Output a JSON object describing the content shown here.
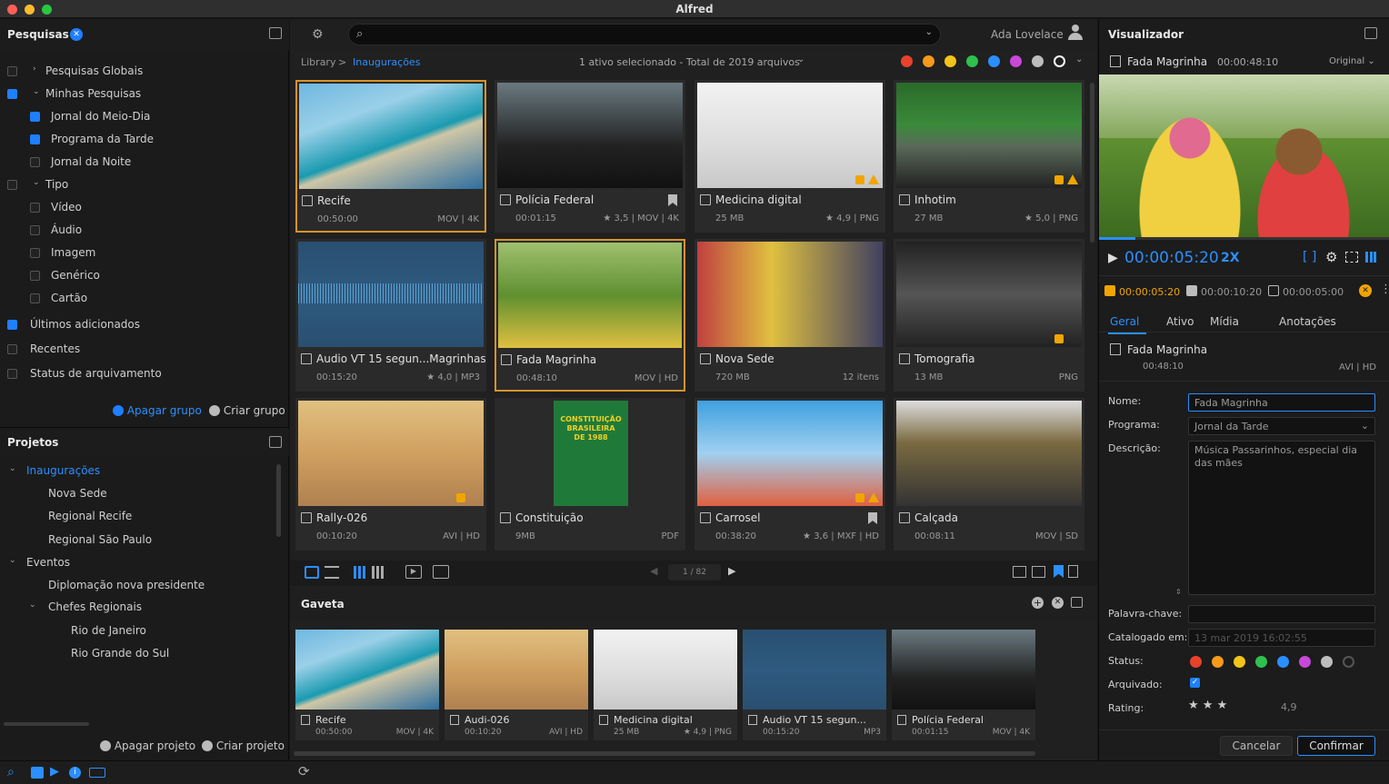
{
  "window": {
    "title": "Alfred"
  },
  "searches": {
    "title": "Pesquisas",
    "items": [
      {
        "label": "Pesquisas Globais"
      },
      {
        "label": "Minhas Pesquisas"
      },
      {
        "label": "Jornal do Meio-Dia"
      },
      {
        "label": "Programa da Tarde"
      },
      {
        "label": "Jornal da Noite"
      },
      {
        "label": "Tipo"
      },
      {
        "label": "Vídeo"
      },
      {
        "label": "Áudio"
      },
      {
        "label": "Imagem"
      },
      {
        "label": "Genérico"
      },
      {
        "label": "Cartão"
      },
      {
        "label": "Últimos adicionados"
      },
      {
        "label": "Recentes"
      },
      {
        "label": "Status de arquivamento"
      }
    ],
    "delete_group": "Apagar grupo",
    "create_group": "Criar grupo"
  },
  "projects": {
    "title": "Projetos",
    "items": [
      {
        "label": "Inaugurações"
      },
      {
        "label": "Nova Sede"
      },
      {
        "label": "Regional Recife"
      },
      {
        "label": "Regional São Paulo"
      },
      {
        "label": "Eventos"
      },
      {
        "label": "Diplomação nova presidente"
      },
      {
        "label": "Chefes Regionais"
      },
      {
        "label": "Rio de Janeiro"
      },
      {
        "label": "Rio Grande do Sul"
      }
    ],
    "delete_project": "Apagar projeto",
    "create_project": "Criar projeto"
  },
  "header": {
    "user": "Ada Lovelace"
  },
  "breadcrumb": {
    "root": "Library",
    "sep": ">",
    "current": "Inaugurações"
  },
  "selection_info": "1 ativo selecionado - Total de 2019 arquivos",
  "color_filters": [
    "#e8412c",
    "#f59a1b",
    "#f2c41a",
    "#2fc04d",
    "#2b8fff",
    "#c848d8",
    "#bdbdbd",
    "#ffffff"
  ],
  "grid": [
    {
      "name": "Recife",
      "meta": "00:50:00",
      "info": "MOV | 4K"
    },
    {
      "name": "Polícia Federal",
      "meta": "00:01:15",
      "info": "★ 3,5 | MOV | 4K"
    },
    {
      "name": "Medicina digital",
      "meta": "25 MB",
      "info": "★ 4,9 | PNG"
    },
    {
      "name": "Inhotim",
      "meta": "27 MB",
      "info": "★ 5,0 | PNG"
    },
    {
      "name": "Audio VT 15 segun...Magrinhas",
      "meta": "00:15:20",
      "info": "★ 4,0 | MP3"
    },
    {
      "name": "Fada Magrinha",
      "meta": "00:48:10",
      "info": "MOV | HD"
    },
    {
      "name": "Nova Sede",
      "meta": "720 MB",
      "info": "12 itens"
    },
    {
      "name": "Tomografia",
      "meta": "13 MB",
      "info": "PNG"
    },
    {
      "name": "Rally-026",
      "meta": "00:10:20",
      "info": "AVI | HD"
    },
    {
      "name": "Constituição",
      "meta": "9MB",
      "info": "PDF"
    },
    {
      "name": "Carrosel",
      "meta": "00:38:20",
      "info": "★ 3,6 | MXF | HD"
    },
    {
      "name": "Calçada",
      "meta": "00:08:11",
      "info": "MOV | SD"
    }
  ],
  "constitution_cover": {
    "line1": "CONSTITUIÇÃO",
    "line2": "BRASILEIRA",
    "line3": "DE 1988"
  },
  "pager": {
    "value": "1 / 82"
  },
  "drawer": {
    "title": "Gaveta",
    "items": [
      {
        "name": "Recife",
        "meta": "00:50:00",
        "info": "MOV | 4K"
      },
      {
        "name": "Audi-026",
        "meta": "00:10:20",
        "info": "AVI | HD"
      },
      {
        "name": "Medicina digital",
        "meta": "25 MB",
        "info": "★ 4,9 | PNG"
      },
      {
        "name": "Audio VT 15 segun...",
        "meta": "00:15:20",
        "info": "MP3"
      },
      {
        "name": "Polícia Federal",
        "meta": "00:01:15",
        "info": "MOV | 4K"
      }
    ]
  },
  "viewer": {
    "title": "Visualizador",
    "clip": "Fada Magrinha",
    "clip_time": "00:00:48:10",
    "quality": "Original",
    "timecode": "00:00:05:20",
    "speed": "2X",
    "in_point": "00:00:05:20",
    "out_point": "00:00:10:20",
    "duration": "00:00:05:00",
    "tabs": [
      "Geral",
      "Ativo",
      "Mídia",
      "Anotações"
    ],
    "asset_name": "Fada Magrinha",
    "asset_time": "00:48:10",
    "asset_info": "AVI | HD",
    "fields": {
      "name_label": "Nome:",
      "name_value": "Fada Magrinha",
      "program_label": "Programa:",
      "program_value": "Jornal da Tarde",
      "desc_label": "Descrição:",
      "desc_value": "Música Passarinhos, especial dia das mães",
      "keyword_label": "Palavra-chave:",
      "cataloged_label": "Catalogado em:",
      "cataloged_value": "13 mar 2019 16:02:55",
      "status_label": "Status:",
      "archived_label": "Arquivado:",
      "rating_label": "Rating:",
      "rating_value": "4,9",
      "rating_stars": "★ ★ ★"
    },
    "status_colors": [
      "#e8412c",
      "#f59a1b",
      "#f2c41a",
      "#2fc04d",
      "#2b8fff",
      "#c848d8",
      "#bdbdbd",
      "#555555"
    ],
    "cancel": "Cancelar",
    "confirm": "Confirmar"
  }
}
